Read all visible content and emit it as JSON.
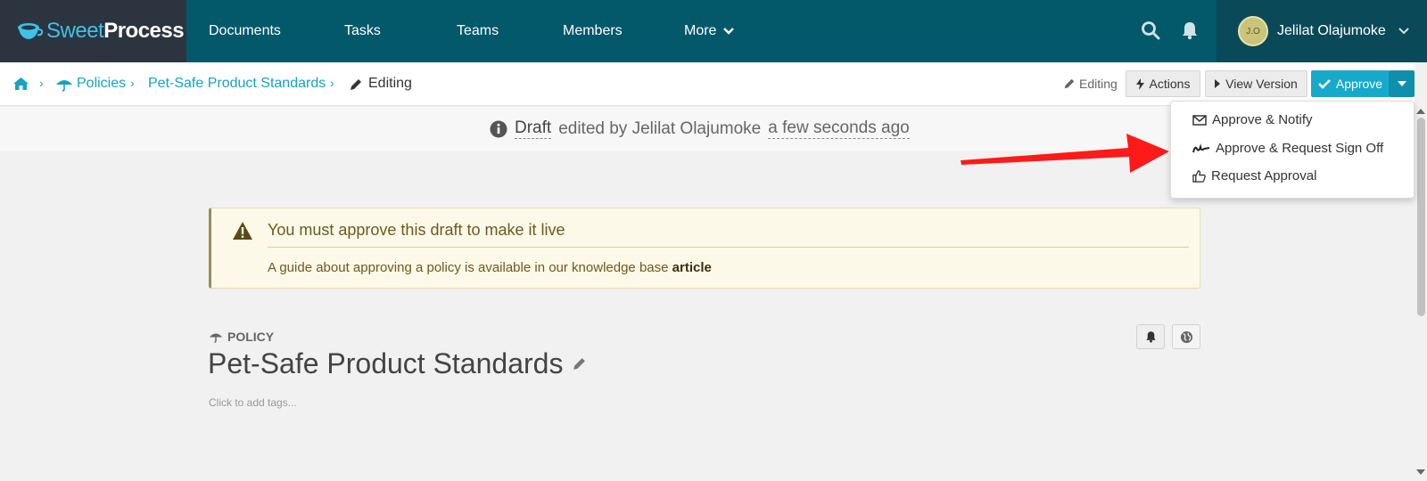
{
  "app": {
    "logo_sweet": "Sweet",
    "logo_process": "Process"
  },
  "nav": {
    "items": [
      "Documents",
      "Tasks",
      "Teams",
      "Members",
      "More"
    ],
    "user_name": "Jelilat Olajumoke",
    "avatar_text": "J.O"
  },
  "breadcrumb": {
    "policies": "Policies",
    "document": "Pet-Safe Product Standards",
    "current": "Editing"
  },
  "toolbar": {
    "status": "Editing",
    "actions": "Actions",
    "view_version": "View Version",
    "approve": "Approve"
  },
  "approve_menu": {
    "items": [
      "Approve & Notify",
      "Approve & Request Sign Off",
      "Request Approval"
    ]
  },
  "draft_line": {
    "draft": "Draft",
    "edited_by": "edited by Jelilat Olajumoke",
    "when": "a few seconds ago"
  },
  "warning": {
    "title": "You must approve this draft to make it live",
    "body": "A guide about approving a policy is available in our knowledge base",
    "link": "article"
  },
  "policy": {
    "type_label": "POLICY",
    "title": "Pet-Safe Product Standards",
    "tags_placeholder": "Click to add tags..."
  },
  "colors": {
    "nav_bg": "#03586a",
    "accent": "#17a9c9",
    "arrow": "#ff0000"
  }
}
